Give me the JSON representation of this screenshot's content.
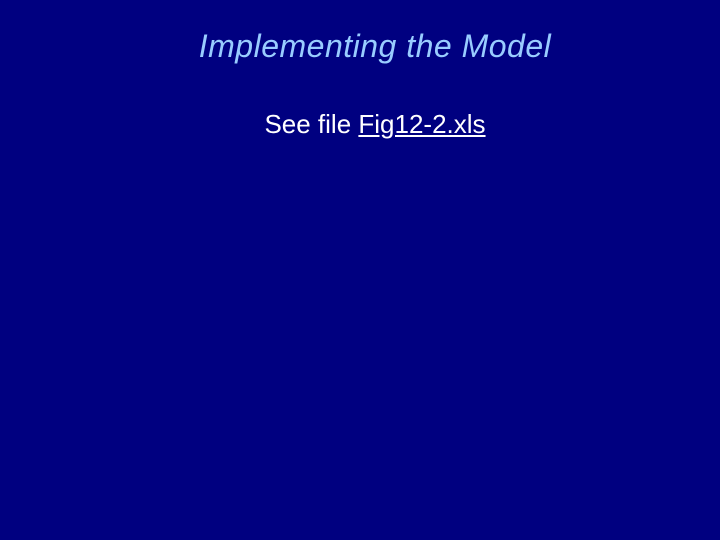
{
  "slide": {
    "title": "Implementing the Model",
    "body_prefix": "See file ",
    "file_link": "Fig12-2.xls"
  }
}
